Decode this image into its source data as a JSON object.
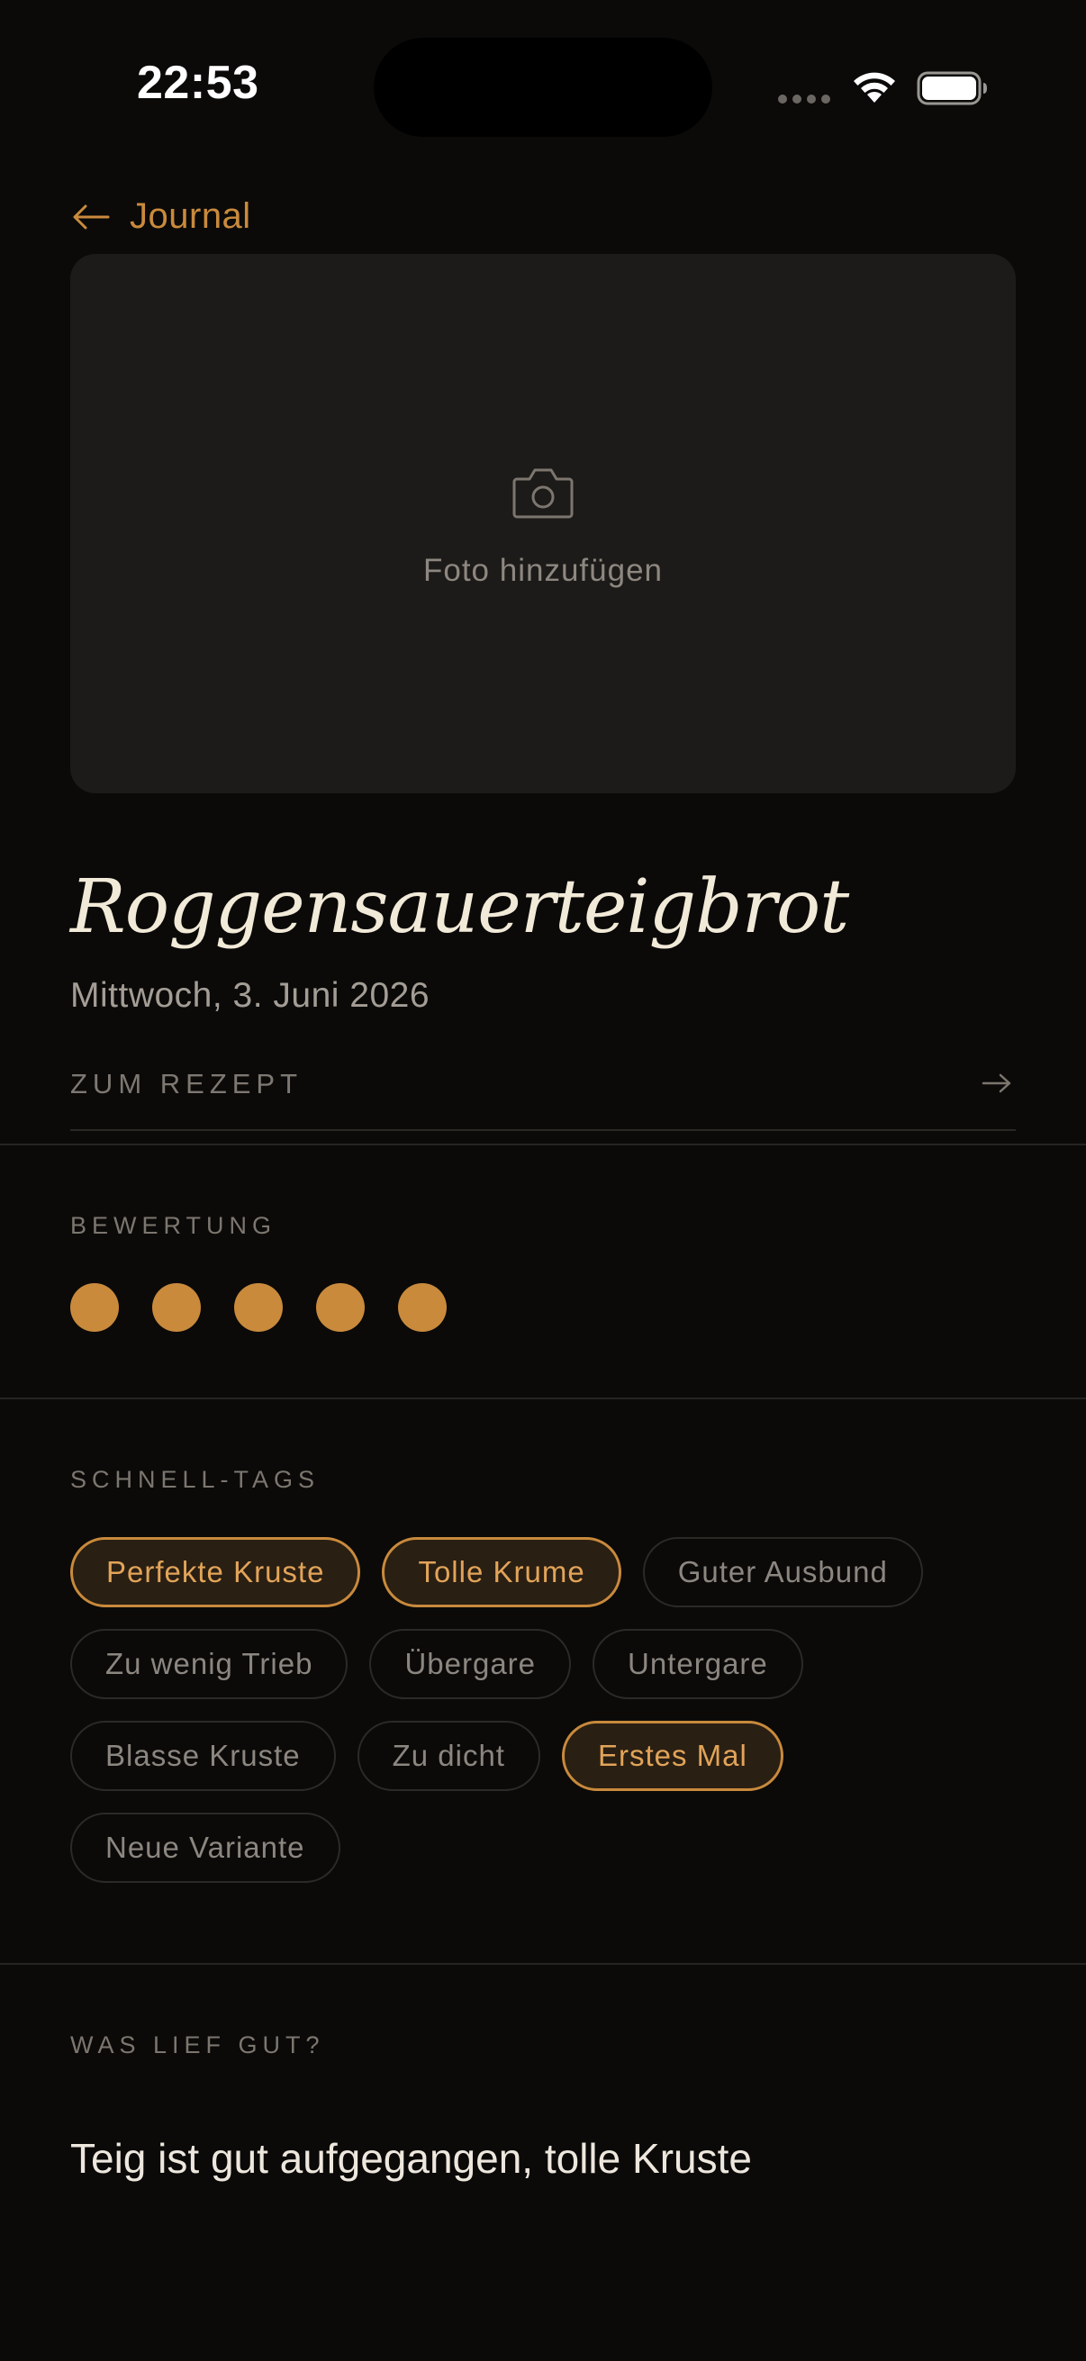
{
  "status_bar": {
    "time": "22:53"
  },
  "nav": {
    "back_label": "Journal",
    "back_icon": "arrow-left-icon"
  },
  "photo": {
    "label": "Foto hinzufügen",
    "icon": "camera-icon"
  },
  "entry": {
    "title": "Roggensauerteigbrot",
    "date": "Mittwoch, 3. Juni 2026",
    "recipe_link_label": "ZUM REZEPT",
    "recipe_link_icon": "arrow-right-icon"
  },
  "rating": {
    "label": "BEWERTUNG",
    "value": 5,
    "max": 5
  },
  "quick_tags": {
    "label": "SCHNELL-TAGS",
    "rows": [
      [
        {
          "label": "Perfekte Kruste",
          "selected": true
        },
        {
          "label": "Tolle Krume",
          "selected": true
        },
        {
          "label": "Guter Ausbund",
          "selected": false
        }
      ],
      [
        {
          "label": "Zu wenig Trieb",
          "selected": false
        },
        {
          "label": "Übergare",
          "selected": false
        },
        {
          "label": "Untergare",
          "selected": false
        }
      ],
      [
        {
          "label": "Blasse Kruste",
          "selected": false
        },
        {
          "label": "Zu dicht",
          "selected": false
        },
        {
          "label": "Erstes Mal",
          "selected": true
        }
      ],
      [
        {
          "label": "Neue Variante",
          "selected": false
        }
      ]
    ]
  },
  "went_well": {
    "label": "WAS LIEF GUT?",
    "text": "Teig ist gut aufgegangen, tolle Kruste"
  },
  "colors": {
    "accent": "#c98a3c",
    "background": "#0b0a09",
    "card": "#1d1b19"
  }
}
